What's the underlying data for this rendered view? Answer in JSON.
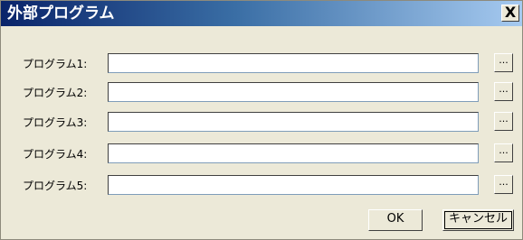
{
  "window": {
    "title": "外部プログラム",
    "close_label": "X"
  },
  "rows": [
    {
      "label": "プログラム1:",
      "value": "",
      "browse_label": "..."
    },
    {
      "label": "プログラム2:",
      "value": "",
      "browse_label": "..."
    },
    {
      "label": "プログラム3:",
      "value": "",
      "browse_label": "..."
    },
    {
      "label": "プログラム4:",
      "value": "",
      "browse_label": "..."
    },
    {
      "label": "プログラム5:",
      "value": "",
      "browse_label": "..."
    }
  ],
  "buttons": {
    "ok_label": "OK",
    "cancel_label": "キャンセル"
  },
  "colors": {
    "titlebar_start": "#0a246a",
    "titlebar_end": "#a6caf0",
    "face": "#ece9d8"
  }
}
